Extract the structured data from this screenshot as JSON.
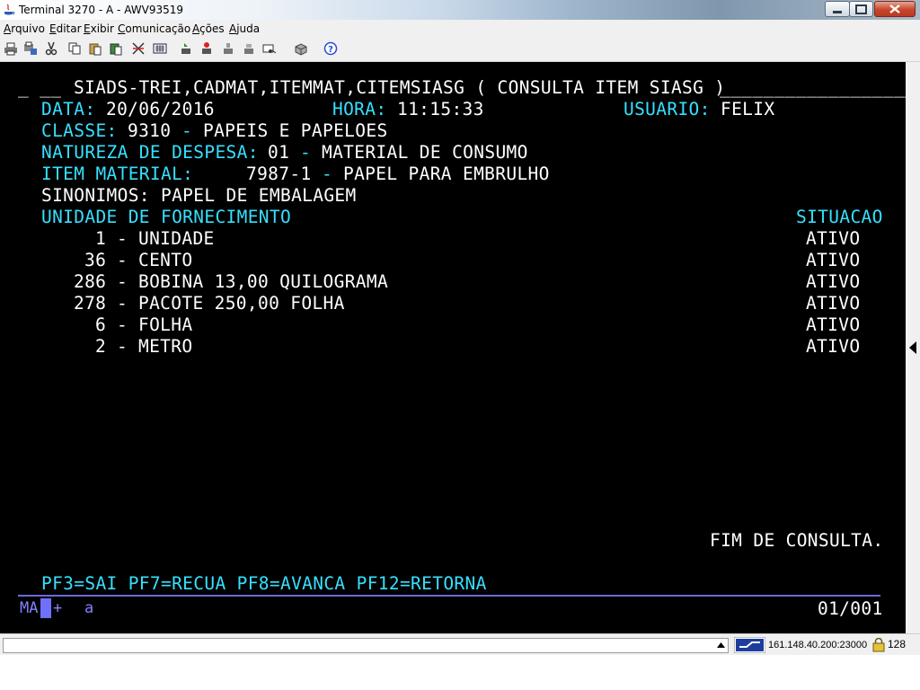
{
  "window": {
    "title": "Terminal 3270 - A - AWV93519",
    "controls": {
      "minimize_icon": "minimize-icon",
      "maximize_icon": "maximize-icon",
      "close_icon": "close-icon"
    }
  },
  "menu": {
    "items": [
      {
        "first": "A",
        "rest": "rquivo"
      },
      {
        "first": "E",
        "rest": "ditar"
      },
      {
        "first": "E",
        "rest": "xibir"
      },
      {
        "first": "C",
        "rest": "omunicação"
      },
      {
        "first": "A",
        "rest": "ções"
      },
      {
        "first": "A",
        "rest": "juda"
      }
    ]
  },
  "toolbar": {
    "icons": [
      "print-icon",
      "print-setup-icon",
      "cut-icon",
      "copy-icon",
      "paste-icon",
      "paste-special-icon",
      "select-all-icon",
      "keyboard-icon",
      "macro-record-icon",
      "macro-stop-icon",
      "macro-play-icon",
      "macro-edit-icon",
      "send-receive-icon",
      "connect-icon",
      "help-icon"
    ]
  },
  "screen": {
    "header": {
      "prefix": "_ __ ",
      "command": "SIADS-TREI,CADMAT,ITEMMAT,CITEMSIASG ( CONSULTA ITEM SIASG )",
      "fill": "____________________"
    },
    "data_label": "DATA:",
    "data_value": "20/06/2016",
    "hora_label": "HORA:",
    "hora_value": "11:15:33",
    "usuario_label": "USUARIO:",
    "usuario_value": "FELIX",
    "classe_label": "CLASSE:",
    "classe_code": "9310",
    "classe_sep": "-",
    "classe_desc": "PAPEIS E PAPELOES",
    "natureza_label": "NATUREZA DE DESPESA:",
    "natureza_code": "01",
    "natureza_sep": "-",
    "natureza_desc": "MATERIAL DE CONSUMO",
    "item_label": "ITEM MATERIAL:",
    "item_code": "7987-1",
    "item_sep": "-",
    "item_desc": "PAPEL PARA EMBRULHO",
    "sinonimos": "SINONIMOS: PAPEL DE EMBALAGEM",
    "col_unidade": "UNIDADE DE FORNECIMENTO",
    "col_situacao": "SITUACAO",
    "rows": [
      {
        "code": "1",
        "desc": "UNIDADE",
        "status": "ATIVO"
      },
      {
        "code": "36",
        "desc": "CENTO",
        "status": "ATIVO"
      },
      {
        "code": "286",
        "desc": "BOBINA 13,00 QUILOGRAMA",
        "status": "ATIVO"
      },
      {
        "code": "278",
        "desc": "PACOTE 250,00 FOLHA",
        "status": "ATIVO"
      },
      {
        "code": "6",
        "desc": "FOLHA",
        "status": "ATIVO"
      },
      {
        "code": "2",
        "desc": "METRO",
        "status": "ATIVO"
      }
    ],
    "row_sep": "-",
    "message": "FIM DE CONSULTA.",
    "pf_keys": "PF3=SAI PF7=RECUA PF8=AVANCA PF12=RETORNA"
  },
  "oia": {
    "indicator": "MA",
    "plus": "+",
    "session": "a",
    "cursor_pos": "01/001"
  },
  "statusbar": {
    "host": "161.148.40.200:23000",
    "code": "128",
    "arrow_icon": "scroll-up-arrow-icon",
    "connection_icon": "connection-icon",
    "lock_icon": "lock-icon"
  },
  "colors": {
    "cyan": "#36e0ff",
    "white": "#ffffff",
    "oia_blue": "#8080ff",
    "terminal_bg": "#000000"
  }
}
